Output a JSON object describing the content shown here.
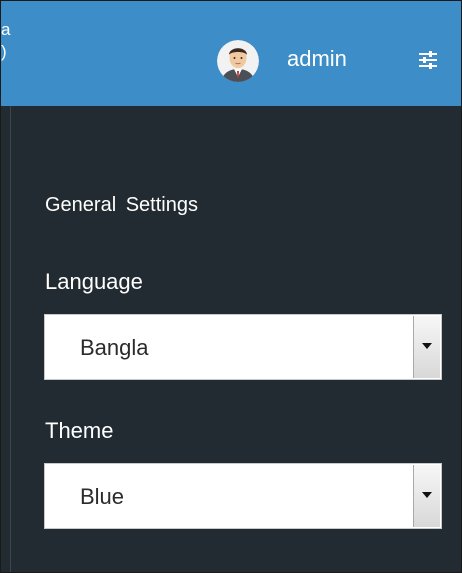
{
  "header": {
    "cut_text": "a\n)",
    "username": "admin",
    "avatar_icon": "user-avatar-icon",
    "settings_icon": "sliders-icon",
    "bg_color": "#3d8ec8"
  },
  "panel": {
    "title": "General Settings",
    "bg_color": "#222b31",
    "language": {
      "label": "Language",
      "value": "Bangla"
    },
    "theme": {
      "label": "Theme",
      "value": "Blue"
    }
  }
}
